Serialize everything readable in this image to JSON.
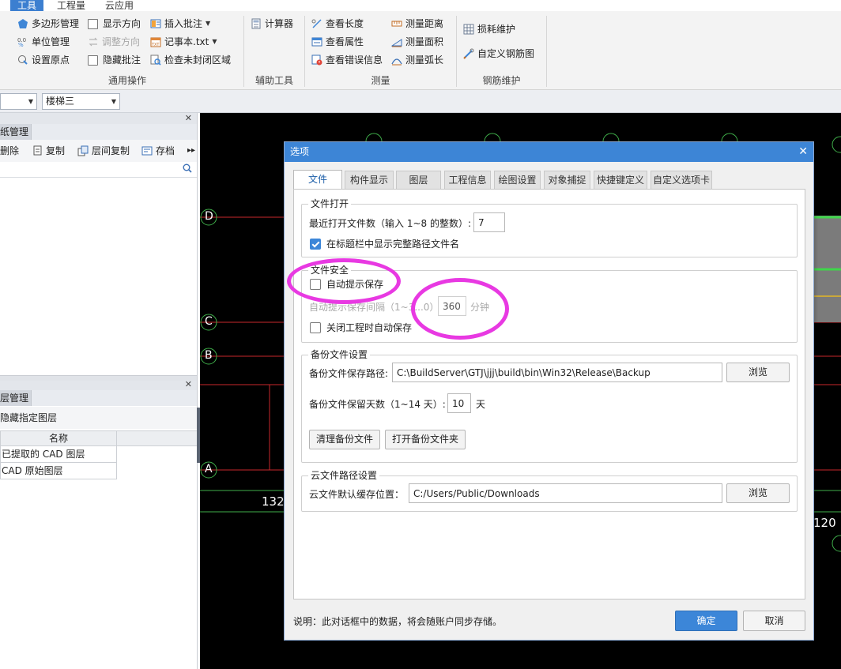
{
  "ribbon_tabs": [
    "工具",
    "工程量",
    "云应用"
  ],
  "ribbon": {
    "general": {
      "polygon": "多边形管理",
      "show_direction": "显示方向",
      "insert_note": "插入批注",
      "unit": "单位管理",
      "adjust_direction": "调整方向",
      "notepad": "记事本.txt",
      "origin": "设置原点",
      "hide_note": "隐藏批注",
      "check_unclosed": "检查未封闭区域",
      "group": "通用操作"
    },
    "aux": {
      "calculator": "计算器",
      "group": "辅助工具"
    },
    "measure": {
      "length": "查看长度",
      "distance": "测量距离",
      "attribute": "查看属性",
      "area": "测量面积",
      "error": "查看错误信息",
      "arc": "测量弧长",
      "group": "测量"
    },
    "rebar": {
      "loss": "损耗维护",
      "custom": "自定义钢筋图",
      "group": "钢筋维护"
    }
  },
  "toolbar": {
    "floor_combo": "楼梯三"
  },
  "left_panel": {
    "drawing_tab": "纸管理",
    "delete": "删除",
    "copy": "复制",
    "floor_copy": "层间复制",
    "save": "存档",
    "layer_tab": "层管理",
    "hide_layer": "隐藏指定图层",
    "col_name": "名称",
    "rows": [
      "已提取的 CAD 图层",
      "CAD 原始图层"
    ]
  },
  "cad": {
    "axes": [
      "D",
      "C",
      "B",
      "A"
    ],
    "dim_left": "132",
    "dim_right": "120"
  },
  "dialog": {
    "title": "选项",
    "tabs": [
      "文件",
      "构件显示",
      "图层",
      "工程信息",
      "绘图设置",
      "对象捕捉",
      "快捷键定义",
      "自定义选项卡"
    ],
    "open": {
      "legend": "文件打开",
      "recent_label": "最近打开文件数（输入 1~8 的整数）:",
      "recent_value": "7",
      "show_full_path": "在标题栏中显示完整路径文件名"
    },
    "security": {
      "legend": "文件安全",
      "auto_prompt": "自动提示保存",
      "interval_label": "自动提示保存间隔（1~3...0）",
      "interval_value": "360",
      "interval_unit": "分钟",
      "close_autosave": "关闭工程时自动保存"
    },
    "backup": {
      "legend": "备份文件设置",
      "path_label": "备份文件保存路径:",
      "path_value": "C:\\BuildServer\\GTJ\\jjj\\build\\bin\\Win32\\Release\\Backup",
      "browse": "浏览",
      "days_label": "备份文件保留天数（1~14 天）:",
      "days_value": "10",
      "days_unit": "天",
      "clean": "清理备份文件",
      "open_folder": "打开备份文件夹"
    },
    "cloud": {
      "legend": "云文件路径设置",
      "path_label": "云文件默认缓存位置：",
      "path_value": "C:/Users/Public/Downloads",
      "browse": "浏览"
    },
    "note": "说明：此对话框中的数据，将会随账户同步存储。",
    "ok": "确定",
    "cancel": "取消"
  },
  "colors": {
    "accent": "#3c86d8",
    "annotation": "#e839e2",
    "cad_bg": "#000000"
  }
}
